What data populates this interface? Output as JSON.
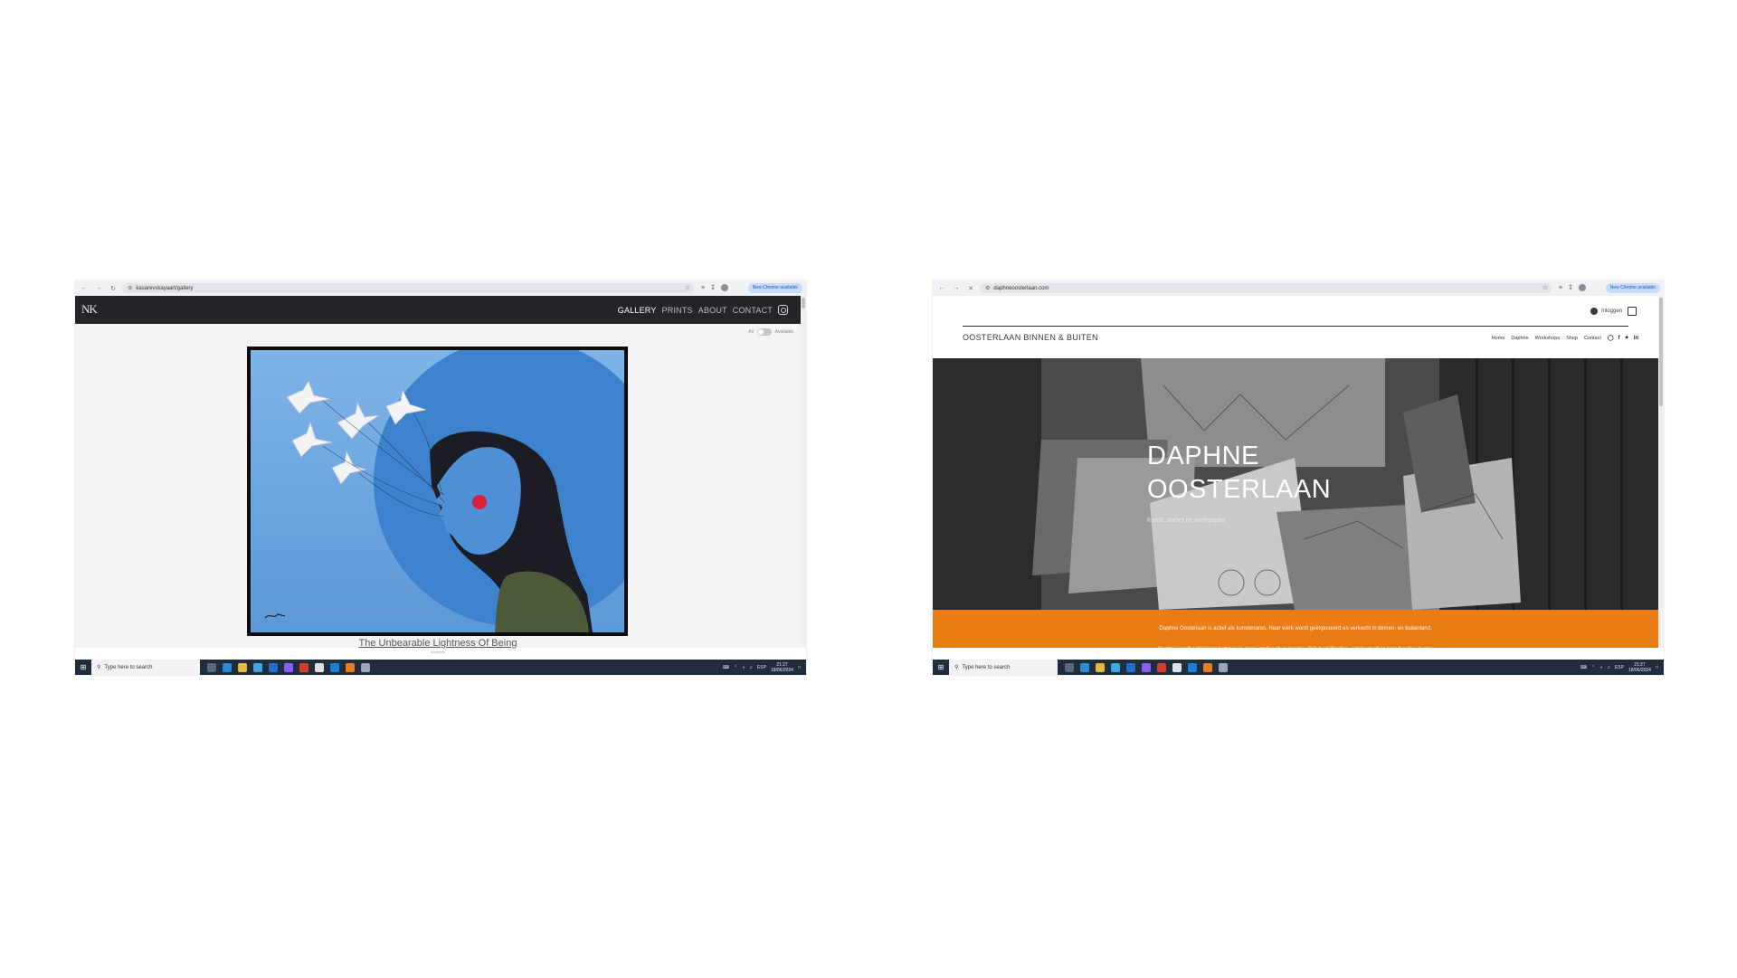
{
  "left_screen": {
    "browser": {
      "url": "kasarevskayaart/gallery",
      "new_chrome": "New Chrome available"
    },
    "site": {
      "logo": "NK",
      "nav": [
        "GALLERY",
        "PRINTS",
        "ABOUT",
        "CONTACT"
      ],
      "toggle_left": "All",
      "toggle_right": "Available",
      "artwork_title": "The Unbearable Lightness Of Being",
      "artwork_sub": "Available"
    },
    "taskbar": {
      "search_placeholder": "Type here to search",
      "language": "ESP",
      "time": "21:27",
      "date": "18/06/2024"
    }
  },
  "right_screen": {
    "browser": {
      "url": "daphneoosterlaan.com",
      "new_chrome": "New Chrome available"
    },
    "site": {
      "login": "Inloggen",
      "brand": "OOSTERLAAN BINNEN & BUITEN",
      "nav": [
        "Home",
        "Daphne",
        "Workshops",
        "Shop",
        "Contact"
      ],
      "hero_title_line1": "DAPHNE",
      "hero_title_line2": "OOSTERLAAN",
      "hero_subtitle": "Kunst, atelier en werkplaats",
      "paragraph1": "Daphne Oosterlaan is actief als kunstenares. Haar werk wordt geëxposeerd en verkocht in binnen- en buitenland.",
      "paragraph2": "Daphne geeft schilderworkshops in eigen atelier of op locatie. Ook bedrijfsuitjes, jubileum of andere feestjes kunt u"
    },
    "taskbar": {
      "search_placeholder": "Type here to search",
      "language": "ESP",
      "time": "21:27",
      "date": "18/06/2024"
    }
  },
  "colors": {
    "nk_header": "#232528",
    "orange_band": "#ea7c16",
    "taskbar": "#1f2d3d"
  }
}
